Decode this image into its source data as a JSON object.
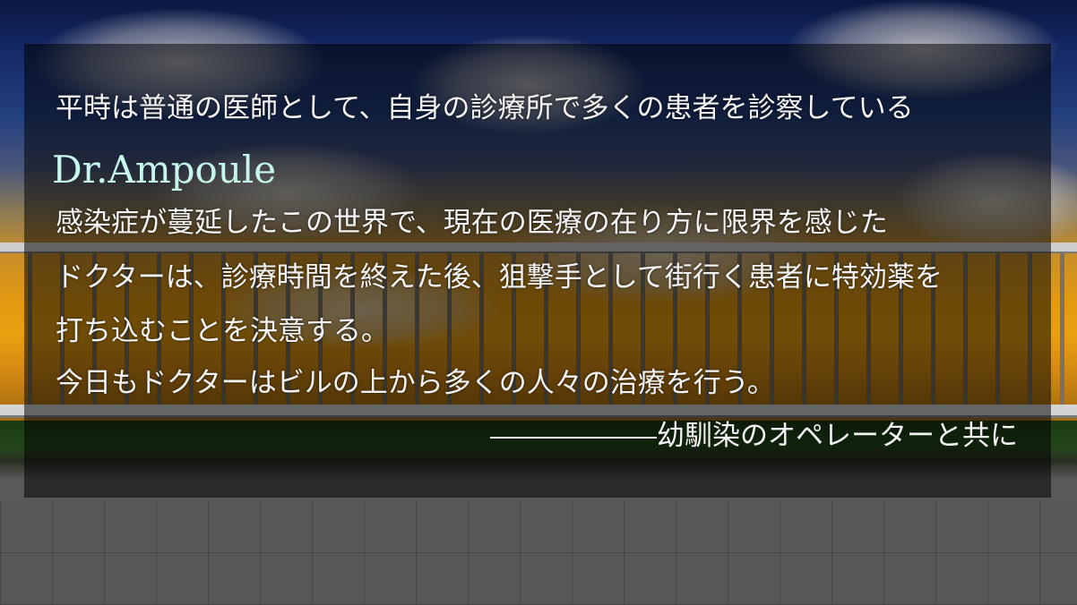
{
  "story": {
    "line1": "平時は普通の医師として、自身の診療所で多くの患者を診察している",
    "title": "Dr.Ampoule",
    "line2": "感染症が蔓延したこの世界で、現在の医療の在り方に限界を感じた",
    "line3": "ドクターは、診療時間を終えた後、狙撃手として街行く患者に特効薬を",
    "line4": "打ち込むことを決意する。",
    "line5": "今日もドクターはビルの上から多くの人々の治療を行う。",
    "signature": "――――――幼馴染のオペレーターと共に"
  },
  "colors": {
    "title": "#c6f6ee",
    "text": "#f4f4f4",
    "panel": "rgba(0,0,0,0.52)"
  }
}
